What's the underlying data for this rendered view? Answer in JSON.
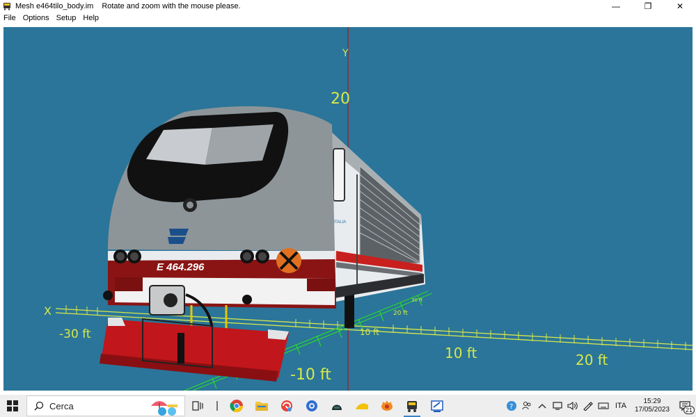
{
  "window": {
    "title": "Mesh e464tilo_body.im",
    "hint": "Rotate and zoom with the mouse please.",
    "minimize": "—",
    "restore": "❐",
    "close": "✕"
  },
  "menu": {
    "items": [
      {
        "label": "File"
      },
      {
        "label": "Options"
      },
      {
        "label": "Setup"
      },
      {
        "label": "Help"
      }
    ]
  },
  "viewport": {
    "background": "#2a7599",
    "axis_color": "#d8e84a",
    "grid_color_z": "#2bd82b",
    "labels": {
      "y_axis": "Y",
      "y_twenty": "20",
      "x_axis": "X",
      "neg30": "-30 ft",
      "neg10": "-10 ft",
      "pos10": "10 ft",
      "pos20": "20 ft",
      "z_small_a": "10 ft",
      "z_small_b": "20 ft",
      "z_small_c": "30 ft"
    },
    "loco": {
      "number": "E 464.296",
      "brand": "TRENITALIA"
    }
  },
  "taskbar": {
    "search_placeholder": "Cerca",
    "apps": [
      {
        "name": "task-view"
      },
      {
        "name": "widgets"
      },
      {
        "name": "chrome"
      },
      {
        "name": "file-explorer"
      },
      {
        "name": "app-red"
      },
      {
        "name": "app-blue"
      },
      {
        "name": "app-dark"
      },
      {
        "name": "app-yellow"
      },
      {
        "name": "app-orange"
      },
      {
        "name": "mesh-viewer"
      },
      {
        "name": "app-editor"
      }
    ],
    "tray": {
      "language": "ITA",
      "time": "15:29",
      "date": "17/05/2023",
      "notifications": "21"
    }
  }
}
